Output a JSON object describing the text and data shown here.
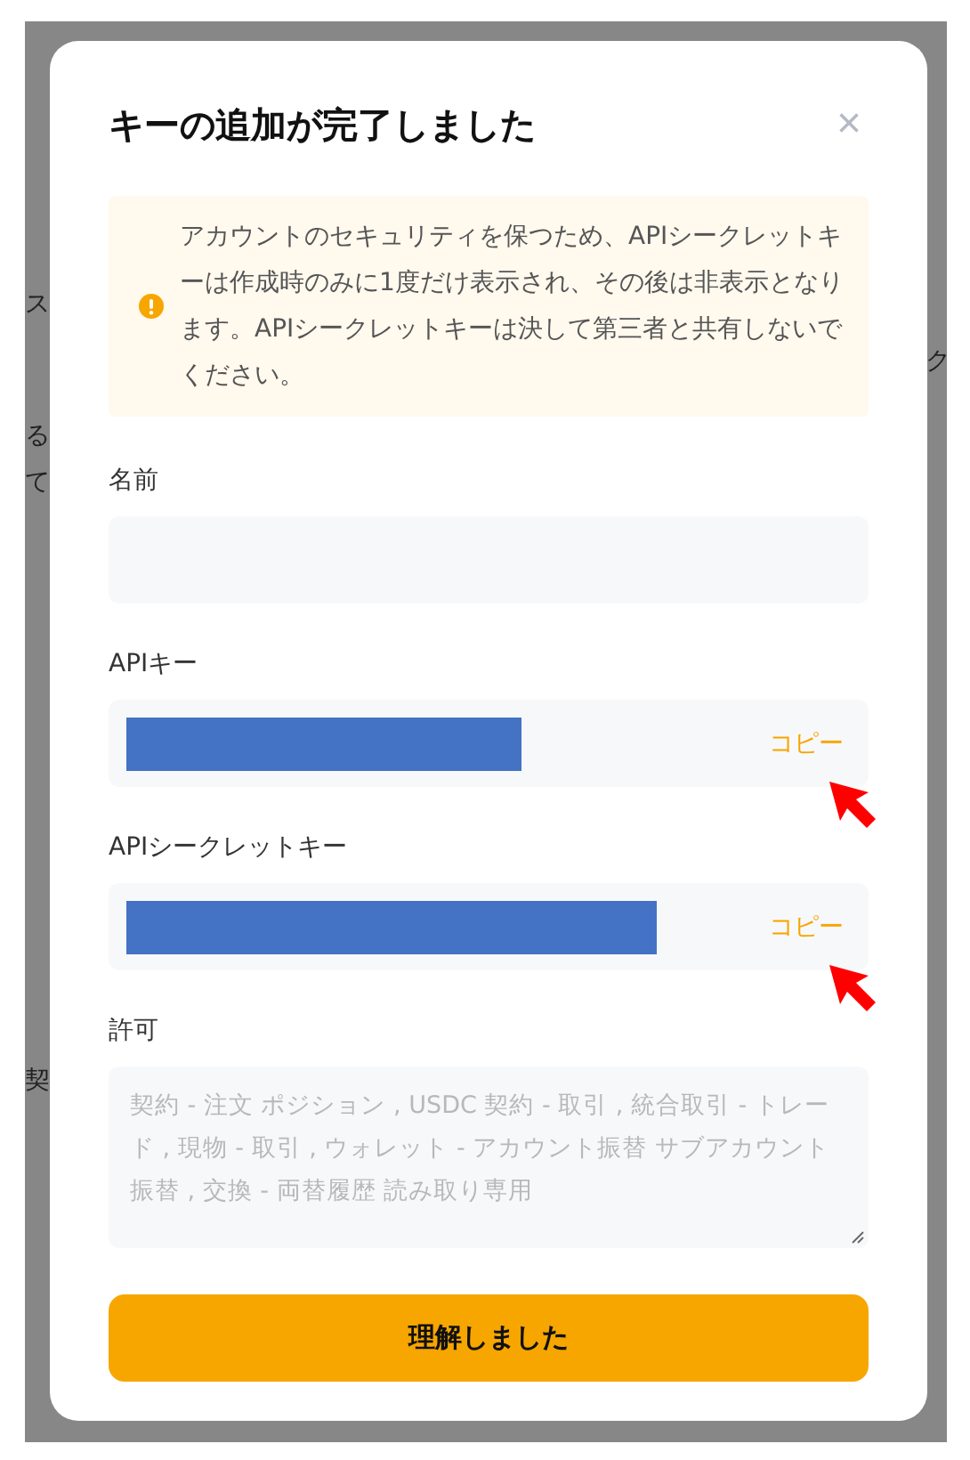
{
  "background_left": [
    "ス",
    "る",
    "て",
    "契"
  ],
  "background_right": [
    "ク"
  ],
  "dialog": {
    "title": "キーの追加が完了しました",
    "close": "×",
    "notice": {
      "kind": "warning",
      "text": "アカウントのセキュリティを保つため、APIシークレットキーは作成時のみに1度だけ表示され、その後は非表示となります。APIシークレットキーは決して第三者と共有しないでください。"
    },
    "fields": [
      {
        "kind": "text",
        "label": "名前"
      },
      {
        "kind": "secret",
        "label": "APIキー",
        "redacted": true,
        "action": "コピー"
      },
      {
        "kind": "secret",
        "label": "APIシークレットキー",
        "redacted": true,
        "action": "コピー"
      },
      {
        "kind": "textarea",
        "label": "許可",
        "value": "契約 - 注文 ポジション , USDC 契約 - 取引 , 統合取引 - トレード , 現物 - 取引 , ウォレット - アカウント振替 サブアカウント振替 , 交換 - 両替履歴  読み取り専用",
        "disabled": true
      }
    ],
    "button": "理解しました"
  }
}
